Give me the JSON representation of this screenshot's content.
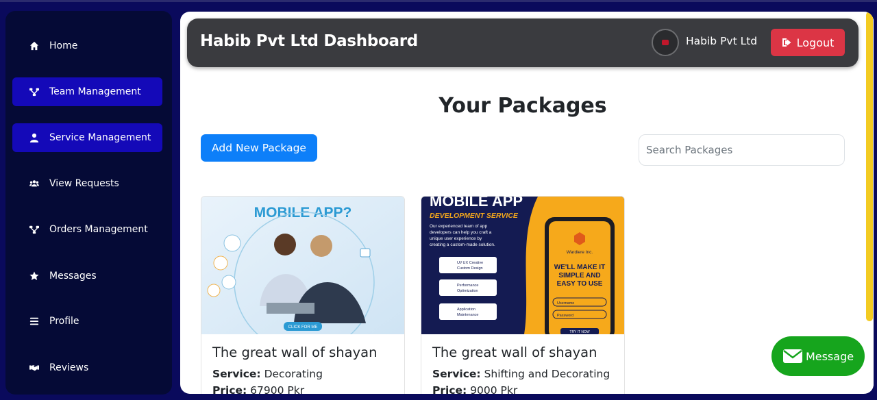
{
  "sidebar": {
    "items": [
      {
        "label": "Home",
        "icon": "home-icon",
        "active": false
      },
      {
        "label": "Team Management",
        "icon": "sitemap-icon",
        "active": true
      },
      {
        "label": "Service Management",
        "icon": "user-icon",
        "active": true
      },
      {
        "label": "View Requests",
        "icon": "users-icon",
        "active": false
      },
      {
        "label": "Orders Management",
        "icon": "sitemap-icon",
        "active": false
      },
      {
        "label": "Messages",
        "icon": "star-icon",
        "active": false
      },
      {
        "label": "Profile",
        "icon": "bars-icon",
        "active": false
      },
      {
        "label": "Reviews",
        "icon": "handshake-icon",
        "active": false
      }
    ]
  },
  "header": {
    "title": "Habib Pvt Ltd Dashboard",
    "company": "Habib Pvt Ltd",
    "logout_label": "Logout"
  },
  "main": {
    "title": "Your Packages",
    "add_label": "Add New Package",
    "search_placeholder": "Search Packages"
  },
  "cards": [
    {
      "title": "The great wall of shayan",
      "service_label": "Service:",
      "service": "Decorating",
      "price_label": "Price:",
      "price": "67900 Pkr",
      "image": {
        "headline": "MOBILE APP?",
        "button": "CLICK FOR ME"
      }
    },
    {
      "title": "The great wall of shayan",
      "service_label": "Service:",
      "service": "Shifting and Decorating",
      "price_label": "Price:",
      "price": "9000 Pkr",
      "image": {
        "headline": "MOBILE APP",
        "subhead": "DEVELOPMENT SERVICE",
        "desc1": "Our experienced team of app",
        "desc2": "developers can help you craft a",
        "desc3": "unique user experience by",
        "desc4": "creating a custom-made solution.",
        "f1a": "UI/ UX Creative",
        "f1b": "Custom Design",
        "f2a": "Performance",
        "f2b": "Optimization",
        "f3a": "Application",
        "f3b": "Maintenance",
        "brand": "Wardiere Inc.",
        "slogan1": "WE'LL MAKE IT",
        "slogan2": "SIMPLE AND",
        "slogan3": "EASY TO USE",
        "username": "Username",
        "password": "Password",
        "cta": "TRY IT NOW"
      }
    }
  ],
  "floating": {
    "message_label": "Message"
  },
  "colors": {
    "background": "#0a0a5c",
    "sidebar": "#050a36",
    "active": "#1409b8",
    "header": "#3a3b3f",
    "logout": "#dc3545",
    "primary": "#0d7ff9",
    "message": "#16a51d",
    "scroll": "#f3cb22"
  }
}
